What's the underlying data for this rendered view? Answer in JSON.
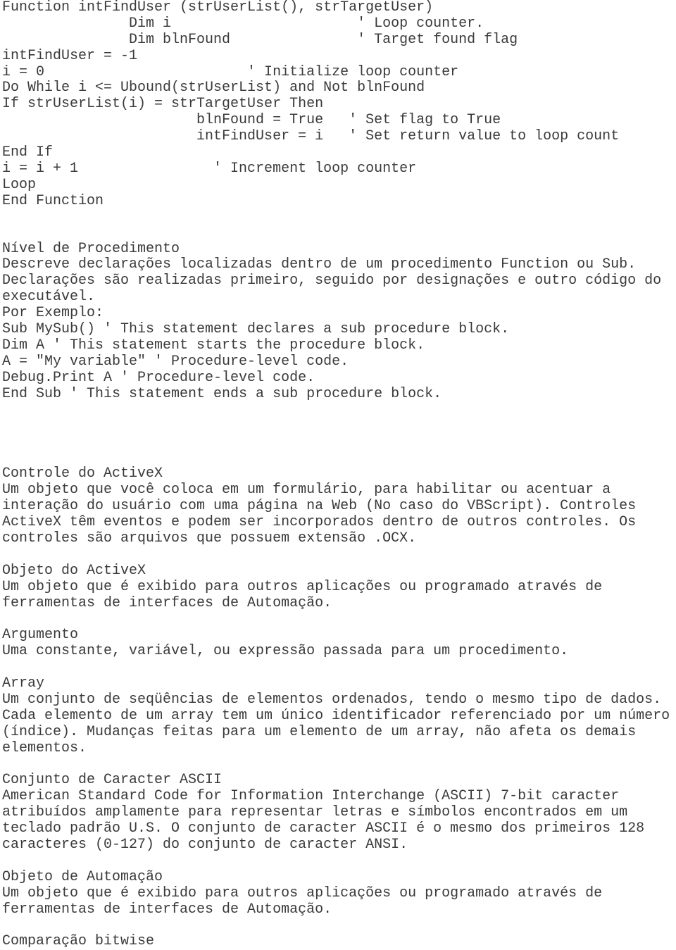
{
  "code_block": {
    "lines": [
      "Function intFindUser (strUserList(), strTargetUser)",
      "               Dim i                      ' Loop counter.",
      "               Dim blnFound               ' Target found flag",
      "intFindUser = -1",
      "i = 0                        ' Initialize loop counter",
      "Do While i <= Ubound(strUserList) and Not blnFound",
      "If strUserList(i) = strTargetUser Then",
      "                       blnFound = True   ' Set flag to True",
      "                       intFindUser = i   ' Set return value to loop count",
      "End If",
      "i = i + 1                ' Increment loop counter",
      "Loop",
      "End Function"
    ]
  },
  "procedure_level": {
    "title": "Nível de Procedimento",
    "lines": [
      "Descreve declarações localizadas dentro de um procedimento Function ou Sub.",
      "Declarações são realizadas primeiro, seguido por designações e outro código do",
      "executável.",
      "Por Exemplo:",
      "Sub MySub() ' This statement declares a sub procedure block.",
      "Dim A ' This statement starts the procedure block.",
      "A = \"My variable\" ' Procedure-level code.",
      "Debug.Print A ' Procedure-level code.",
      "End Sub ' This statement ends a sub procedure block."
    ]
  },
  "glossary": [
    {
      "term": "Controle do ActiveX",
      "lines": [
        "Um objeto que você coloca em um formulário, para habilitar ou acentuar a",
        "interação do usuário com uma página na Web (No caso do VBScript). Controles",
        "ActiveX têm eventos e podem ser incorporados dentro de outros controles. Os",
        "controles são arquivos que possuem extensão .OCX."
      ]
    },
    {
      "term": "Objeto do ActiveX",
      "lines": [
        "Um objeto que é exibido para outros aplicações ou programado através de",
        "ferramentas de interfaces de Automação."
      ]
    },
    {
      "term": "Argumento",
      "lines": [
        "Uma constante, variável, ou expressão passada para um procedimento."
      ]
    },
    {
      "term": "Array",
      "lines": [
        "Um conjunto de seqüências de elementos ordenados, tendo o mesmo tipo de dados.",
        "Cada elemento de um array tem um único identificador referenciado por um número",
        "(índice). Mudanças feitas para um elemento de um array, não afeta os demais",
        "elementos."
      ]
    },
    {
      "term": "Conjunto de Caracter ASCII",
      "lines": [
        "American Standard Code for Information Interchange (ASCII) 7-bit caracter",
        "atribuídos amplamente para representar letras e símbolos encontrados em um",
        "teclado padrão U.S. O conjunto de caracter ASCII é o mesmo dos primeiros 128",
        "caracteres (0-127) do conjunto de caracter ANSI."
      ]
    },
    {
      "term": "Objeto de Automação",
      "lines": [
        "Um objeto que é exibido para outros aplicações ou programado através de",
        "ferramentas de interfaces de Automação."
      ]
    },
    {
      "term": "Comparação bitwise",
      "lines": []
    }
  ]
}
